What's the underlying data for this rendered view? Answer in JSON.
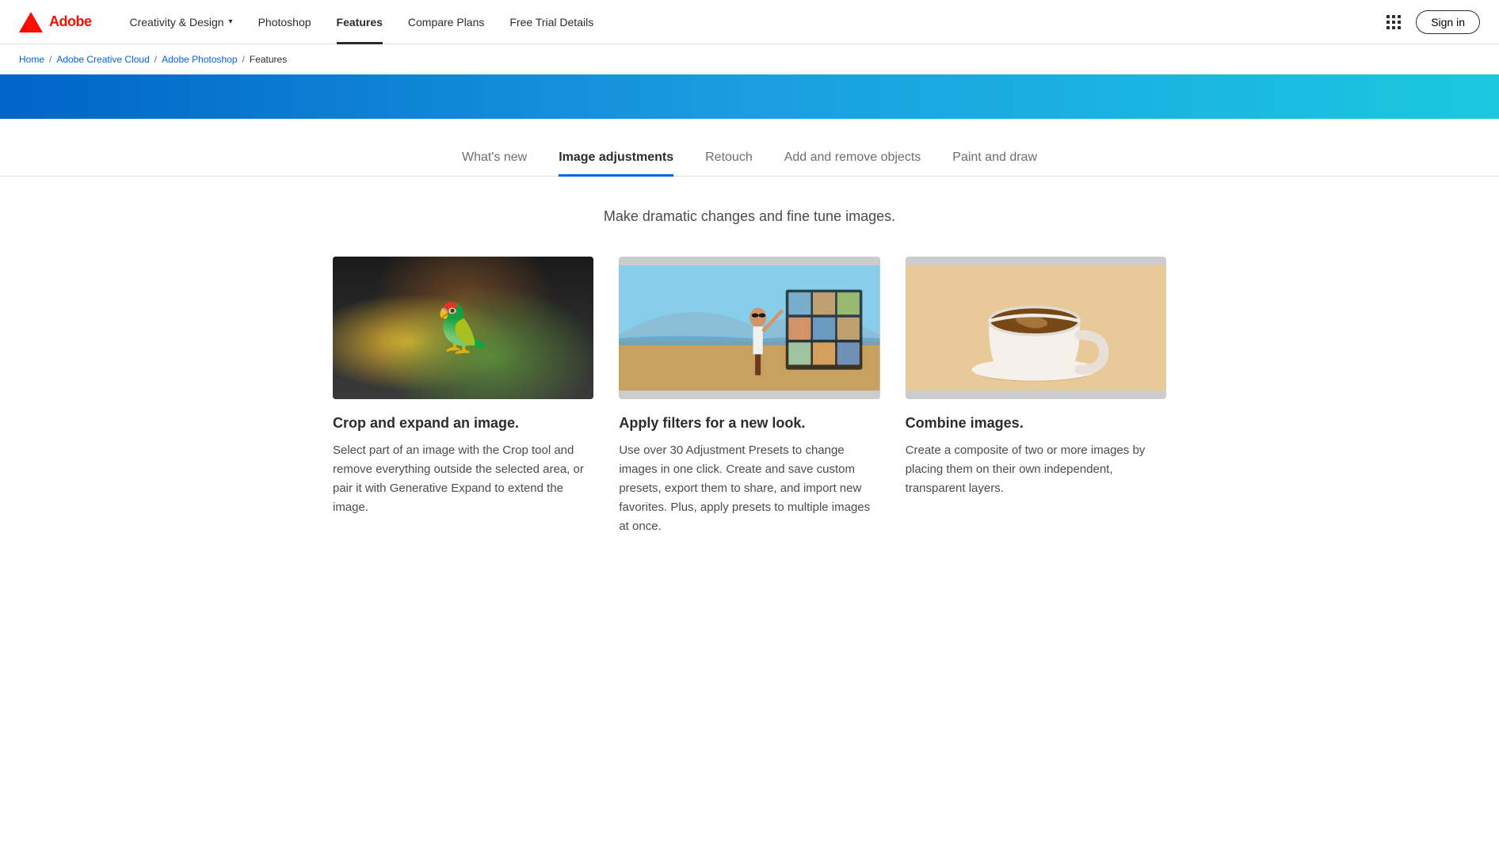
{
  "nav": {
    "brand": "Adobe",
    "creativity_label": "Creativity & Design",
    "photoshop_label": "Photoshop",
    "features_label": "Features",
    "compare_plans_label": "Compare Plans",
    "free_trial_label": "Free Trial Details",
    "sign_in_label": "Sign in"
  },
  "breadcrumb": {
    "home": "Home",
    "creative_cloud": "Adobe Creative Cloud",
    "photoshop": "Adobe Photoshop",
    "current": "Features"
  },
  "tabs": {
    "items": [
      {
        "id": "whats-new",
        "label": "What's new"
      },
      {
        "id": "image-adjustments",
        "label": "Image adjustments"
      },
      {
        "id": "retouch",
        "label": "Retouch"
      },
      {
        "id": "add-remove-objects",
        "label": "Add and remove objects"
      },
      {
        "id": "paint-draw",
        "label": "Paint and draw"
      }
    ],
    "active_index": 1
  },
  "section": {
    "subtitle": "Make dramatic changes and fine tune images."
  },
  "cards": [
    {
      "id": "crop",
      "image_type": "toucan",
      "title": "Crop and expand an image.",
      "description": "Select part of an image with the Crop tool and remove everything outside the selected area, or pair it with Generative Expand to extend the image."
    },
    {
      "id": "filters",
      "image_type": "beach",
      "title": "Apply filters for a new look.",
      "description": "Use over 30 Adjustment Presets to change images in one click. Create and save custom presets, export them to share, and import new favorites. Plus, apply presets to multiple images at once."
    },
    {
      "id": "combine",
      "image_type": "coffee",
      "title": "Combine images.",
      "description": "Create a composite of two or more images by placing them on their own independent, transparent layers."
    }
  ]
}
